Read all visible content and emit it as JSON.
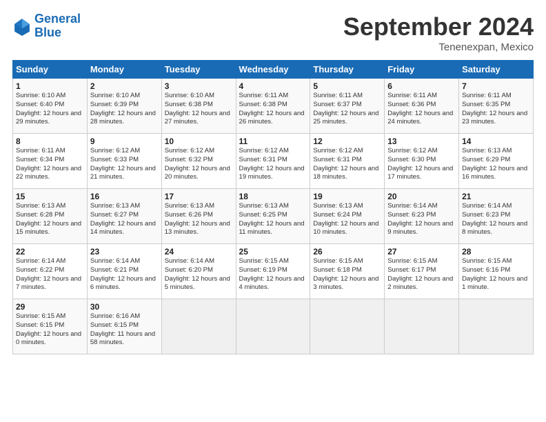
{
  "logo": {
    "line1": "General",
    "line2": "Blue"
  },
  "title": "September 2024",
  "location": "Tenenexpan, Mexico",
  "days_header": [
    "Sunday",
    "Monday",
    "Tuesday",
    "Wednesday",
    "Thursday",
    "Friday",
    "Saturday"
  ],
  "weeks": [
    [
      {
        "day": "1",
        "sunrise": "Sunrise: 6:10 AM",
        "sunset": "Sunset: 6:40 PM",
        "daylight": "Daylight: 12 hours and 29 minutes."
      },
      {
        "day": "2",
        "sunrise": "Sunrise: 6:10 AM",
        "sunset": "Sunset: 6:39 PM",
        "daylight": "Daylight: 12 hours and 28 minutes."
      },
      {
        "day": "3",
        "sunrise": "Sunrise: 6:10 AM",
        "sunset": "Sunset: 6:38 PM",
        "daylight": "Daylight: 12 hours and 27 minutes."
      },
      {
        "day": "4",
        "sunrise": "Sunrise: 6:11 AM",
        "sunset": "Sunset: 6:38 PM",
        "daylight": "Daylight: 12 hours and 26 minutes."
      },
      {
        "day": "5",
        "sunrise": "Sunrise: 6:11 AM",
        "sunset": "Sunset: 6:37 PM",
        "daylight": "Daylight: 12 hours and 25 minutes."
      },
      {
        "day": "6",
        "sunrise": "Sunrise: 6:11 AM",
        "sunset": "Sunset: 6:36 PM",
        "daylight": "Daylight: 12 hours and 24 minutes."
      },
      {
        "day": "7",
        "sunrise": "Sunrise: 6:11 AM",
        "sunset": "Sunset: 6:35 PM",
        "daylight": "Daylight: 12 hours and 23 minutes."
      }
    ],
    [
      {
        "day": "8",
        "sunrise": "Sunrise: 6:11 AM",
        "sunset": "Sunset: 6:34 PM",
        "daylight": "Daylight: 12 hours and 22 minutes."
      },
      {
        "day": "9",
        "sunrise": "Sunrise: 6:12 AM",
        "sunset": "Sunset: 6:33 PM",
        "daylight": "Daylight: 12 hours and 21 minutes."
      },
      {
        "day": "10",
        "sunrise": "Sunrise: 6:12 AM",
        "sunset": "Sunset: 6:32 PM",
        "daylight": "Daylight: 12 hours and 20 minutes."
      },
      {
        "day": "11",
        "sunrise": "Sunrise: 6:12 AM",
        "sunset": "Sunset: 6:31 PM",
        "daylight": "Daylight: 12 hours and 19 minutes."
      },
      {
        "day": "12",
        "sunrise": "Sunrise: 6:12 AM",
        "sunset": "Sunset: 6:31 PM",
        "daylight": "Daylight: 12 hours and 18 minutes."
      },
      {
        "day": "13",
        "sunrise": "Sunrise: 6:12 AM",
        "sunset": "Sunset: 6:30 PM",
        "daylight": "Daylight: 12 hours and 17 minutes."
      },
      {
        "day": "14",
        "sunrise": "Sunrise: 6:13 AM",
        "sunset": "Sunset: 6:29 PM",
        "daylight": "Daylight: 12 hours and 16 minutes."
      }
    ],
    [
      {
        "day": "15",
        "sunrise": "Sunrise: 6:13 AM",
        "sunset": "Sunset: 6:28 PM",
        "daylight": "Daylight: 12 hours and 15 minutes."
      },
      {
        "day": "16",
        "sunrise": "Sunrise: 6:13 AM",
        "sunset": "Sunset: 6:27 PM",
        "daylight": "Daylight: 12 hours and 14 minutes."
      },
      {
        "day": "17",
        "sunrise": "Sunrise: 6:13 AM",
        "sunset": "Sunset: 6:26 PM",
        "daylight": "Daylight: 12 hours and 13 minutes."
      },
      {
        "day": "18",
        "sunrise": "Sunrise: 6:13 AM",
        "sunset": "Sunset: 6:25 PM",
        "daylight": "Daylight: 12 hours and 11 minutes."
      },
      {
        "day": "19",
        "sunrise": "Sunrise: 6:13 AM",
        "sunset": "Sunset: 6:24 PM",
        "daylight": "Daylight: 12 hours and 10 minutes."
      },
      {
        "day": "20",
        "sunrise": "Sunrise: 6:14 AM",
        "sunset": "Sunset: 6:23 PM",
        "daylight": "Daylight: 12 hours and 9 minutes."
      },
      {
        "day": "21",
        "sunrise": "Sunrise: 6:14 AM",
        "sunset": "Sunset: 6:23 PM",
        "daylight": "Daylight: 12 hours and 8 minutes."
      }
    ],
    [
      {
        "day": "22",
        "sunrise": "Sunrise: 6:14 AM",
        "sunset": "Sunset: 6:22 PM",
        "daylight": "Daylight: 12 hours and 7 minutes."
      },
      {
        "day": "23",
        "sunrise": "Sunrise: 6:14 AM",
        "sunset": "Sunset: 6:21 PM",
        "daylight": "Daylight: 12 hours and 6 minutes."
      },
      {
        "day": "24",
        "sunrise": "Sunrise: 6:14 AM",
        "sunset": "Sunset: 6:20 PM",
        "daylight": "Daylight: 12 hours and 5 minutes."
      },
      {
        "day": "25",
        "sunrise": "Sunrise: 6:15 AM",
        "sunset": "Sunset: 6:19 PM",
        "daylight": "Daylight: 12 hours and 4 minutes."
      },
      {
        "day": "26",
        "sunrise": "Sunrise: 6:15 AM",
        "sunset": "Sunset: 6:18 PM",
        "daylight": "Daylight: 12 hours and 3 minutes."
      },
      {
        "day": "27",
        "sunrise": "Sunrise: 6:15 AM",
        "sunset": "Sunset: 6:17 PM",
        "daylight": "Daylight: 12 hours and 2 minutes."
      },
      {
        "day": "28",
        "sunrise": "Sunrise: 6:15 AM",
        "sunset": "Sunset: 6:16 PM",
        "daylight": "Daylight: 12 hours and 1 minute."
      }
    ],
    [
      {
        "day": "29",
        "sunrise": "Sunrise: 6:15 AM",
        "sunset": "Sunset: 6:15 PM",
        "daylight": "Daylight: 12 hours and 0 minutes."
      },
      {
        "day": "30",
        "sunrise": "Sunrise: 6:16 AM",
        "sunset": "Sunset: 6:15 PM",
        "daylight": "Daylight: 11 hours and 58 minutes."
      },
      null,
      null,
      null,
      null,
      null
    ]
  ]
}
